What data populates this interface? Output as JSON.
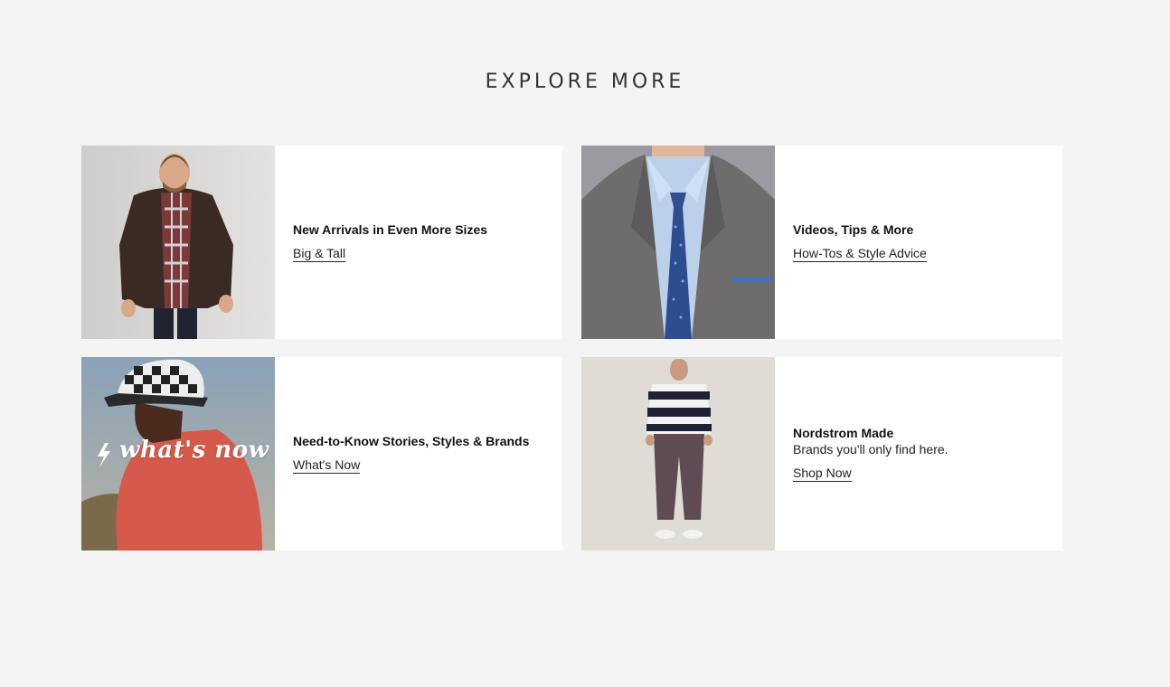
{
  "section": {
    "title": "EXPLORE MORE"
  },
  "cards": [
    {
      "title": "New Arrivals in Even More Sizes",
      "link": "Big & Tall",
      "image": "man-brown-jacket-photo"
    },
    {
      "title": "Videos, Tips & More",
      "link": "How-Tos & Style Advice",
      "image": "suit-and-tie-photo"
    },
    {
      "title": "Need-to-Know Stories, Styles & Brands",
      "link": "What's Now",
      "image": "bucket-hat-red-shirt-photo",
      "overlay": "what's now"
    },
    {
      "title": "Nordstrom Made",
      "description": "Brands you'll only find here.",
      "link": "Shop Now",
      "image": "striped-sweater-man-photo"
    }
  ]
}
